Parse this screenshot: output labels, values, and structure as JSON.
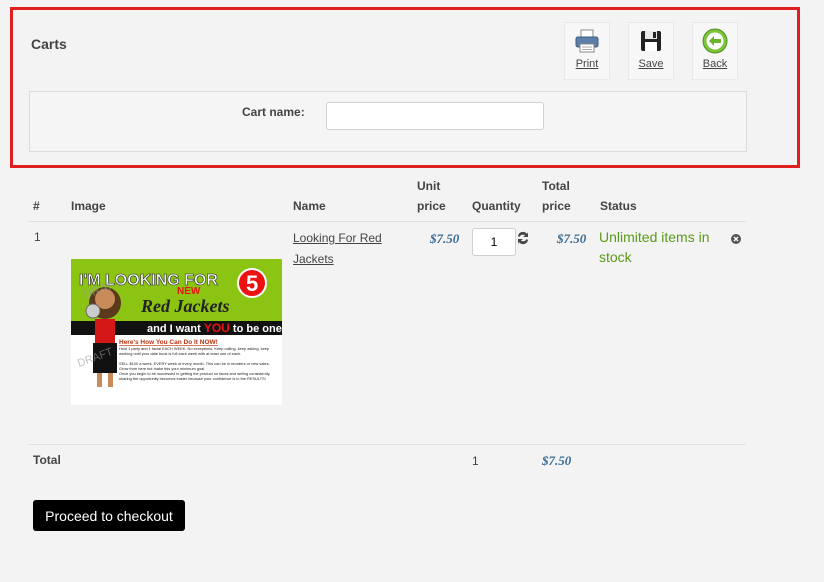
{
  "panel": {
    "title": "Carts",
    "tools": [
      {
        "label": "Print",
        "icon": "printer-icon"
      },
      {
        "label": "Save",
        "icon": "floppy-disk-icon"
      },
      {
        "label": "Back",
        "icon": "back-arrow-icon"
      }
    ],
    "cart_name_label": "Cart name:",
    "cart_name_value": ""
  },
  "table": {
    "headers": {
      "num": "#",
      "image": "Image",
      "name": "Name",
      "unit_price_1": "Unit",
      "unit_price_2": "price",
      "quantity": "Quantity",
      "total_price_1": "Total",
      "total_price_2": "price",
      "status": "Status"
    },
    "rows": [
      {
        "num": "1",
        "name": "Looking For Red Jackets",
        "unit_price": "$7.50",
        "quantity": "1",
        "total_price": "$7.50",
        "status": "Unlimited items in stock",
        "image": {
          "line1": "I'M LOOKING FOR",
          "number": "5",
          "new": "NEW",
          "line2": "Red Jackets",
          "line3a": "and I want",
          "line3b": "YOU",
          "line3c": "to be one!",
          "heading": "Here's How You Can Do It NOW!",
          "b1": "Hold 1 party and 1 facial EACH WEEK. No exceptions. Keep calling, keep asking, keep working until your date book is full each week with at least one of each.",
          "b2": "SELL $100 a week, EVERY week of every month. This can be in reorders or new sales. Grow from here but make this your minimum goal.",
          "b3": "Once you begin to be successful in getting the product on faces and selling consistently, sharing the opportunity becomes easier because your confidence is in the RESULTS!",
          "watermark": "DRAFT"
        }
      }
    ],
    "footer": {
      "label": "Total",
      "quantity": "1",
      "total_price": "$7.50"
    }
  },
  "checkout_label": "Proceed to checkout",
  "colors": {
    "frame": "#e0201f",
    "price": "#3b6c95",
    "status": "#5a9a18"
  }
}
